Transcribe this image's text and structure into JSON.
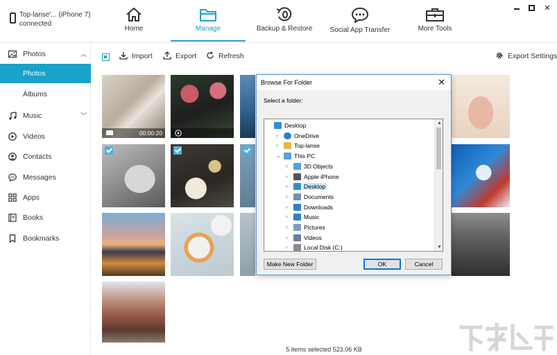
{
  "device": {
    "name": "Top-lanse'... (iPhone 7)",
    "status": "connected"
  },
  "nav": [
    {
      "label": "Home",
      "icon": "home-icon"
    },
    {
      "label": "Manage",
      "icon": "folder-icon",
      "active": true
    },
    {
      "label": "Backup & Restore",
      "icon": "backup-icon"
    },
    {
      "label": "Social App Transfer",
      "icon": "chat-icon"
    },
    {
      "label": "More Tools",
      "icon": "toolbox-icon"
    }
  ],
  "window": {
    "minimize": "—",
    "maximize": "□",
    "close": "✕"
  },
  "sidebar": {
    "photos": "Photos",
    "photos_sub": "Photos",
    "albums": "Albums",
    "music": "Music",
    "videos": "Videos",
    "contacts": "Contacts",
    "messages": "Messages",
    "apps": "Apps",
    "books": "Books",
    "bookmarks": "Bookmarks"
  },
  "toolbar": {
    "import": "Import",
    "export": "Export",
    "refresh": "Refresh",
    "settings": "Export Settings"
  },
  "grid": {
    "video_duration": "00:00:20"
  },
  "status": "5 items selected 523.06 KB",
  "dialog": {
    "title": "Browse For Folder",
    "prompt": "Select a folder:",
    "tree": [
      {
        "label": "Desktop",
        "level": 0,
        "icon": "desktop-icon",
        "expand": ""
      },
      {
        "label": "OneDrive",
        "level": 1,
        "icon": "cloud-icon",
        "expand": "›"
      },
      {
        "label": "Top-lanse",
        "level": 1,
        "icon": "user-folder-icon",
        "expand": "›"
      },
      {
        "label": "This PC",
        "level": 1,
        "icon": "computer-icon",
        "expand": "⌄"
      },
      {
        "label": "3D Objects",
        "level": 2,
        "icon": "cube-icon",
        "expand": "›"
      },
      {
        "label": "Apple iPhone",
        "level": 2,
        "icon": "phone-icon",
        "expand": "›"
      },
      {
        "label": "Desktop",
        "level": 2,
        "icon": "desktop-icon",
        "expand": "›",
        "selected": true
      },
      {
        "label": "Documents",
        "level": 2,
        "icon": "documents-icon",
        "expand": "›"
      },
      {
        "label": "Downloads",
        "level": 2,
        "icon": "download-icon",
        "expand": "›"
      },
      {
        "label": "Music",
        "level": 2,
        "icon": "music-icon",
        "expand": "›"
      },
      {
        "label": "Pictures",
        "level": 2,
        "icon": "pictures-icon",
        "expand": "›"
      },
      {
        "label": "Videos",
        "level": 2,
        "icon": "videos-icon",
        "expand": "›"
      },
      {
        "label": "Local Disk (C:)",
        "level": 2,
        "icon": "disk-icon",
        "expand": "›"
      }
    ],
    "make_new_folder": "Make New Folder",
    "ok": "OK",
    "cancel": "Cancel"
  },
  "colors": {
    "accent": "#1aa3c8",
    "selection": "#cce8ff"
  }
}
